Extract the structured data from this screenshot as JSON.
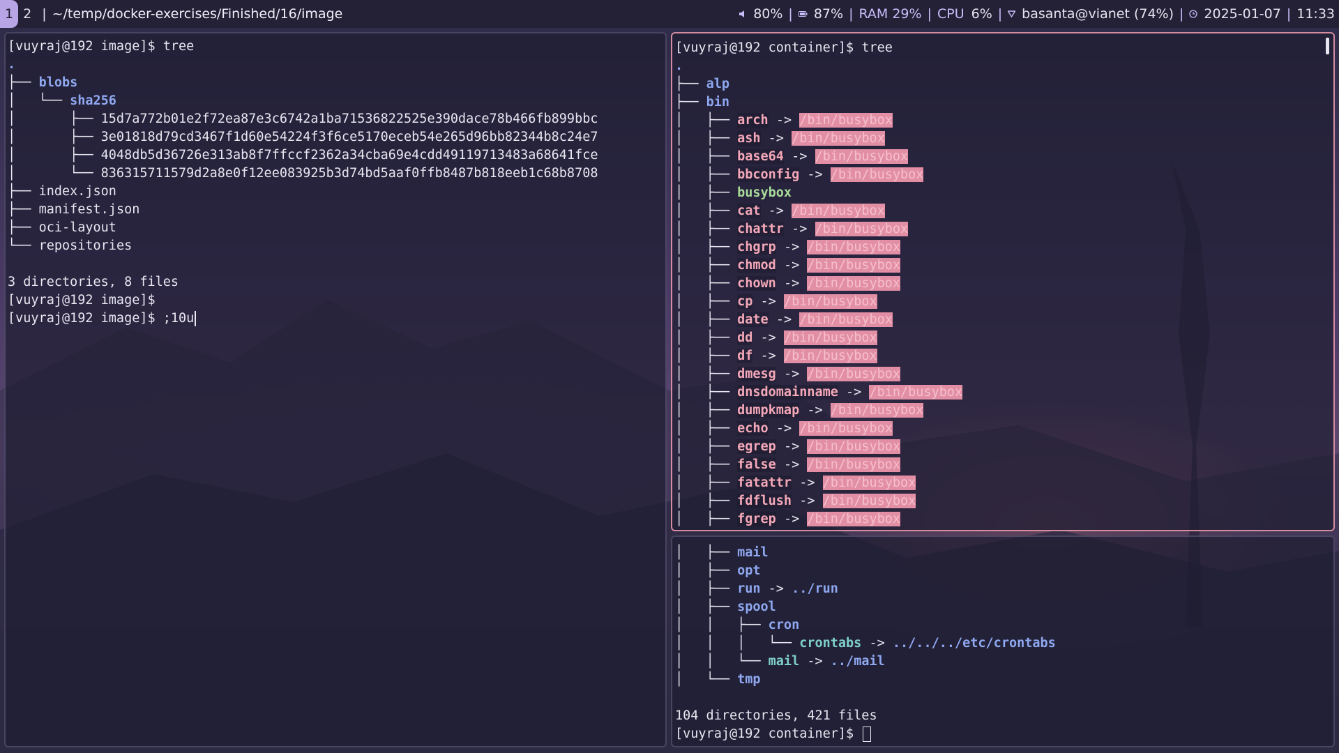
{
  "topbar": {
    "workspaces": [
      "1",
      "2"
    ],
    "title": "~/temp/docker-exercises/Finished/16/image",
    "volume_icon": "speaker-icon",
    "volume": "80%",
    "battery_icon": "battery-icon",
    "battery": "87%",
    "ram": "RAM 29%",
    "cpu_label": "CPU",
    "cpu": "6%",
    "wifi_icon": "wifi-icon",
    "network": "basanta@vianet (74%)",
    "clock_icon": "clock-icon",
    "date": "2025-01-07",
    "time": "11:33"
  },
  "left_terminal": {
    "prompt": "[vuyraj@192 image]$",
    "command": "tree",
    "tree": {
      "root": ".",
      "blobs": "blobs",
      "sha256": "sha256",
      "hashes": [
        "15d7a772b01e2f72ea87e3c6742a1ba71536822525e390dace78b466fb899bbc",
        "3e01818d79cd3467f1d60e54224f3f6ce5170eceb54e265d96bb82344b8c24e7",
        "4048db5d36726e313ab8f7ffccf2362a34cba69e4cdd49119713483a68641fce",
        "836315711579d2a8e0f12ee083925b3d74bd5aaf0ffb8487b818eeb1c68b8708"
      ],
      "files": [
        "index.json",
        "manifest.json",
        "oci-layout",
        "repositories"
      ]
    },
    "summary": "3 directories, 8 files",
    "prompt2": "[vuyraj@192 image]$",
    "prompt3": "[vuyraj@192 image]$",
    "typed": ";10u"
  },
  "right_top_terminal": {
    "prompt": "[vuyraj@192 container]$",
    "command": "tree",
    "root": ".",
    "alp": "alp",
    "bin": "bin",
    "arrow": "->",
    "link_target": "/bin/busybox",
    "entries": [
      {
        "name": "arch",
        "link": true
      },
      {
        "name": "ash",
        "link": true
      },
      {
        "name": "base64",
        "link": true
      },
      {
        "name": "bbconfig",
        "link": true
      },
      {
        "name": "busybox",
        "link": false
      },
      {
        "name": "cat",
        "link": true
      },
      {
        "name": "chattr",
        "link": true
      },
      {
        "name": "chgrp",
        "link": true
      },
      {
        "name": "chmod",
        "link": true
      },
      {
        "name": "chown",
        "link": true
      },
      {
        "name": "cp",
        "link": true
      },
      {
        "name": "date",
        "link": true
      },
      {
        "name": "dd",
        "link": true
      },
      {
        "name": "df",
        "link": true
      },
      {
        "name": "dmesg",
        "link": true
      },
      {
        "name": "dnsdomainname",
        "link": true
      },
      {
        "name": "dumpkmap",
        "link": true
      },
      {
        "name": "echo",
        "link": true
      },
      {
        "name": "egrep",
        "link": true
      },
      {
        "name": "false",
        "link": true
      },
      {
        "name": "fatattr",
        "link": true
      },
      {
        "name": "fdflush",
        "link": true
      },
      {
        "name": "fgrep",
        "link": true
      }
    ]
  },
  "right_bottom_terminal": {
    "mail": "mail",
    "opt": "opt",
    "run": "run",
    "run_target": "../run",
    "spool": "spool",
    "cron": "cron",
    "crontabs": "crontabs",
    "crontabs_target": "../../../etc/crontabs",
    "spool_mail": "mail",
    "spool_mail_target": "../mail",
    "tmp": "tmp",
    "arrow": "->",
    "summary": "104 directories, 421 files",
    "prompt": "[vuyraj@192 container]$"
  },
  "colors": {
    "directory": "#8fa8f0",
    "executable": "#a9dc9a",
    "symlink": "#f4a8b8",
    "symlink_target_bg": "#e28fa5",
    "bar_bg": "#242136",
    "accent": "#b8a5e6"
  }
}
